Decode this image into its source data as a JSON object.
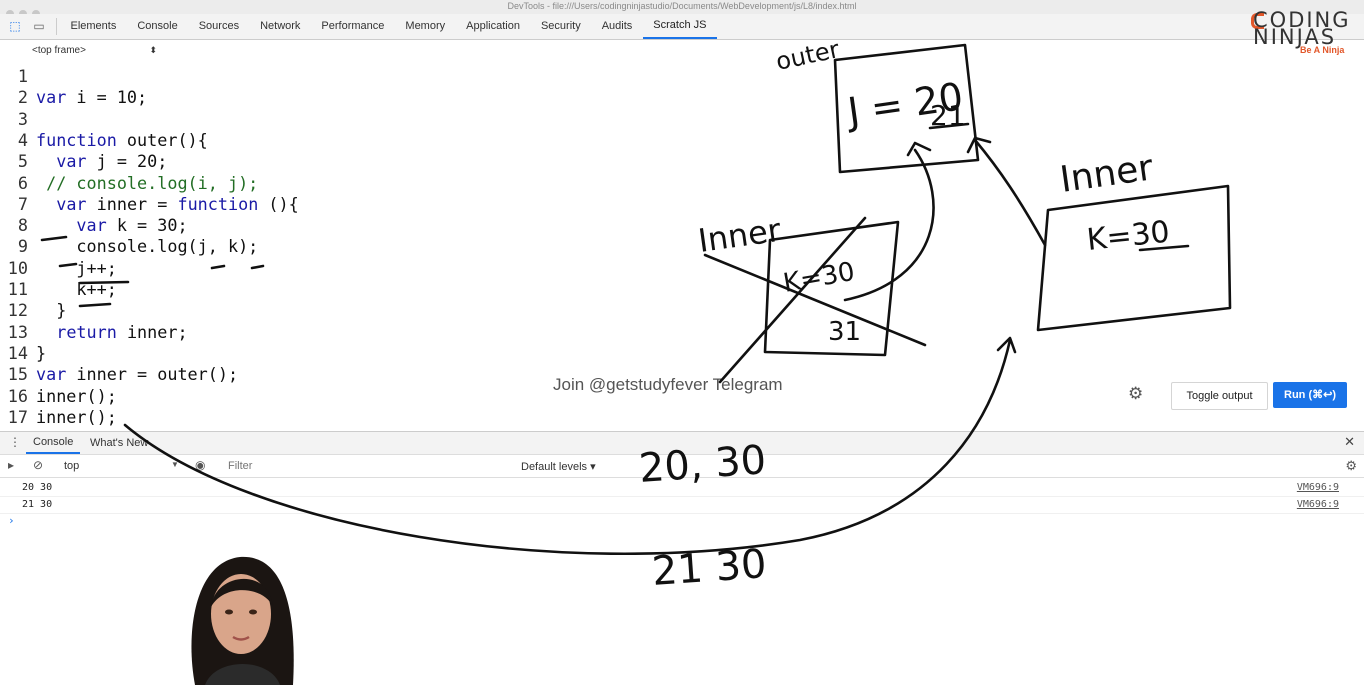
{
  "window": {
    "title": "DevTools - file:///Users/codingninjastudio/Documents/WebDevelopment/js/L8/index.html"
  },
  "devtools": {
    "tabs": [
      "Elements",
      "Console",
      "Sources",
      "Network",
      "Performance",
      "Memory",
      "Application",
      "Security",
      "Audits",
      "Scratch JS"
    ],
    "active_tab": "Scratch JS",
    "frame_selector": "<top frame>"
  },
  "editor": {
    "lines": [
      {
        "n": "1",
        "code": ""
      },
      {
        "n": "2",
        "code": "var i = 10;"
      },
      {
        "n": "3",
        "code": ""
      },
      {
        "n": "4",
        "code": "function outer(){"
      },
      {
        "n": "5",
        "code": "  var j = 20;"
      },
      {
        "n": "6",
        "code": " // console.log(i, j);"
      },
      {
        "n": "7",
        "code": "  var inner = function (){"
      },
      {
        "n": "8",
        "code": "    var k = 30;"
      },
      {
        "n": "9",
        "code": "    console.log(j, k);"
      },
      {
        "n": "10",
        "code": "    j++;"
      },
      {
        "n": "11",
        "code": "    k++;"
      },
      {
        "n": "12",
        "code": "  }"
      },
      {
        "n": "13",
        "code": "  return inner;"
      },
      {
        "n": "14",
        "code": "}"
      },
      {
        "n": "15",
        "code": "var inner = outer();"
      },
      {
        "n": "16",
        "code": "inner();"
      },
      {
        "n": "17",
        "code": "inner();"
      }
    ],
    "toggle_output_label": "Toggle output",
    "run_label": "Run (⌘↩)"
  },
  "watermark": "Join @getstudyfever Telegram",
  "drawer": {
    "tabs": [
      "Console",
      "What's New"
    ],
    "active_tab": "Console",
    "context": "top",
    "filter_placeholder": "Filter",
    "levels": "Default levels ▾"
  },
  "console_logs": [
    {
      "message": "20 30",
      "source": "VM696:9"
    },
    {
      "message": "21 30",
      "source": "VM696:9"
    }
  ],
  "logo": {
    "line1": "CODING",
    "line2": "NINJAS",
    "tagline": "Be A Ninja"
  },
  "annotations": {
    "outer_label": "outer",
    "outer_box": "J = 20",
    "outer_box_new": "21",
    "inner_label_left": "Inner",
    "inner_box_left": "K=30",
    "inner_box_left_new": "31",
    "inner_label_right": "Inner",
    "inner_box_right": "K=30",
    "output_1": "20, 30",
    "output_2": "21  30"
  },
  "colors": {
    "accent": "#1a73e8",
    "keyword": "#1a1aa6",
    "comment": "#236e25",
    "brand": "#e2572a"
  }
}
